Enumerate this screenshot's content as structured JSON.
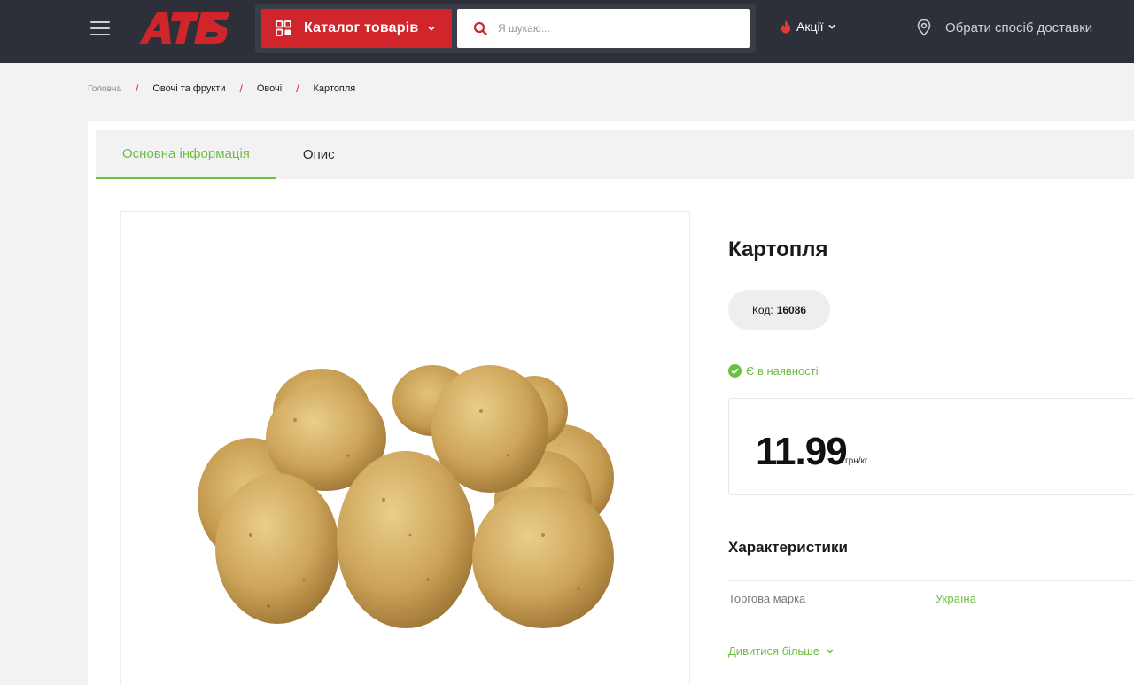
{
  "header": {
    "logo_text": "АТБ",
    "catalog_label": "Каталог товарів",
    "search_placeholder": "Я шукаю...",
    "promo_label": "Акції",
    "delivery_label": "Обрати спосіб доставки"
  },
  "breadcrumb": {
    "items": [
      "Головна",
      "Овочі та фрукти",
      "Овочі",
      "Картопля"
    ],
    "separator": "/"
  },
  "tabs": [
    {
      "label": "Основна інформація",
      "active": true
    },
    {
      "label": "Опис",
      "active": false
    }
  ],
  "product": {
    "title": "Картопля",
    "code_label": "Код:",
    "code_value": "16086",
    "stock_label": "Є в наявності",
    "price": "11.99",
    "unit": "грн/кг"
  },
  "characteristics": {
    "title": "Характеристики",
    "rows": [
      {
        "key": "Торгова марка",
        "value": "Україна"
      }
    ],
    "more_label": "Дивитися більше"
  },
  "colors": {
    "header_bg": "#2e3039",
    "brand_red": "#d0262b",
    "accent_green": "#6cbf3f"
  },
  "icons": [
    "menu-icon",
    "grid-icon",
    "chevron-down-icon",
    "search-icon",
    "fire-icon",
    "location-pin-icon",
    "check-circle-icon"
  ]
}
